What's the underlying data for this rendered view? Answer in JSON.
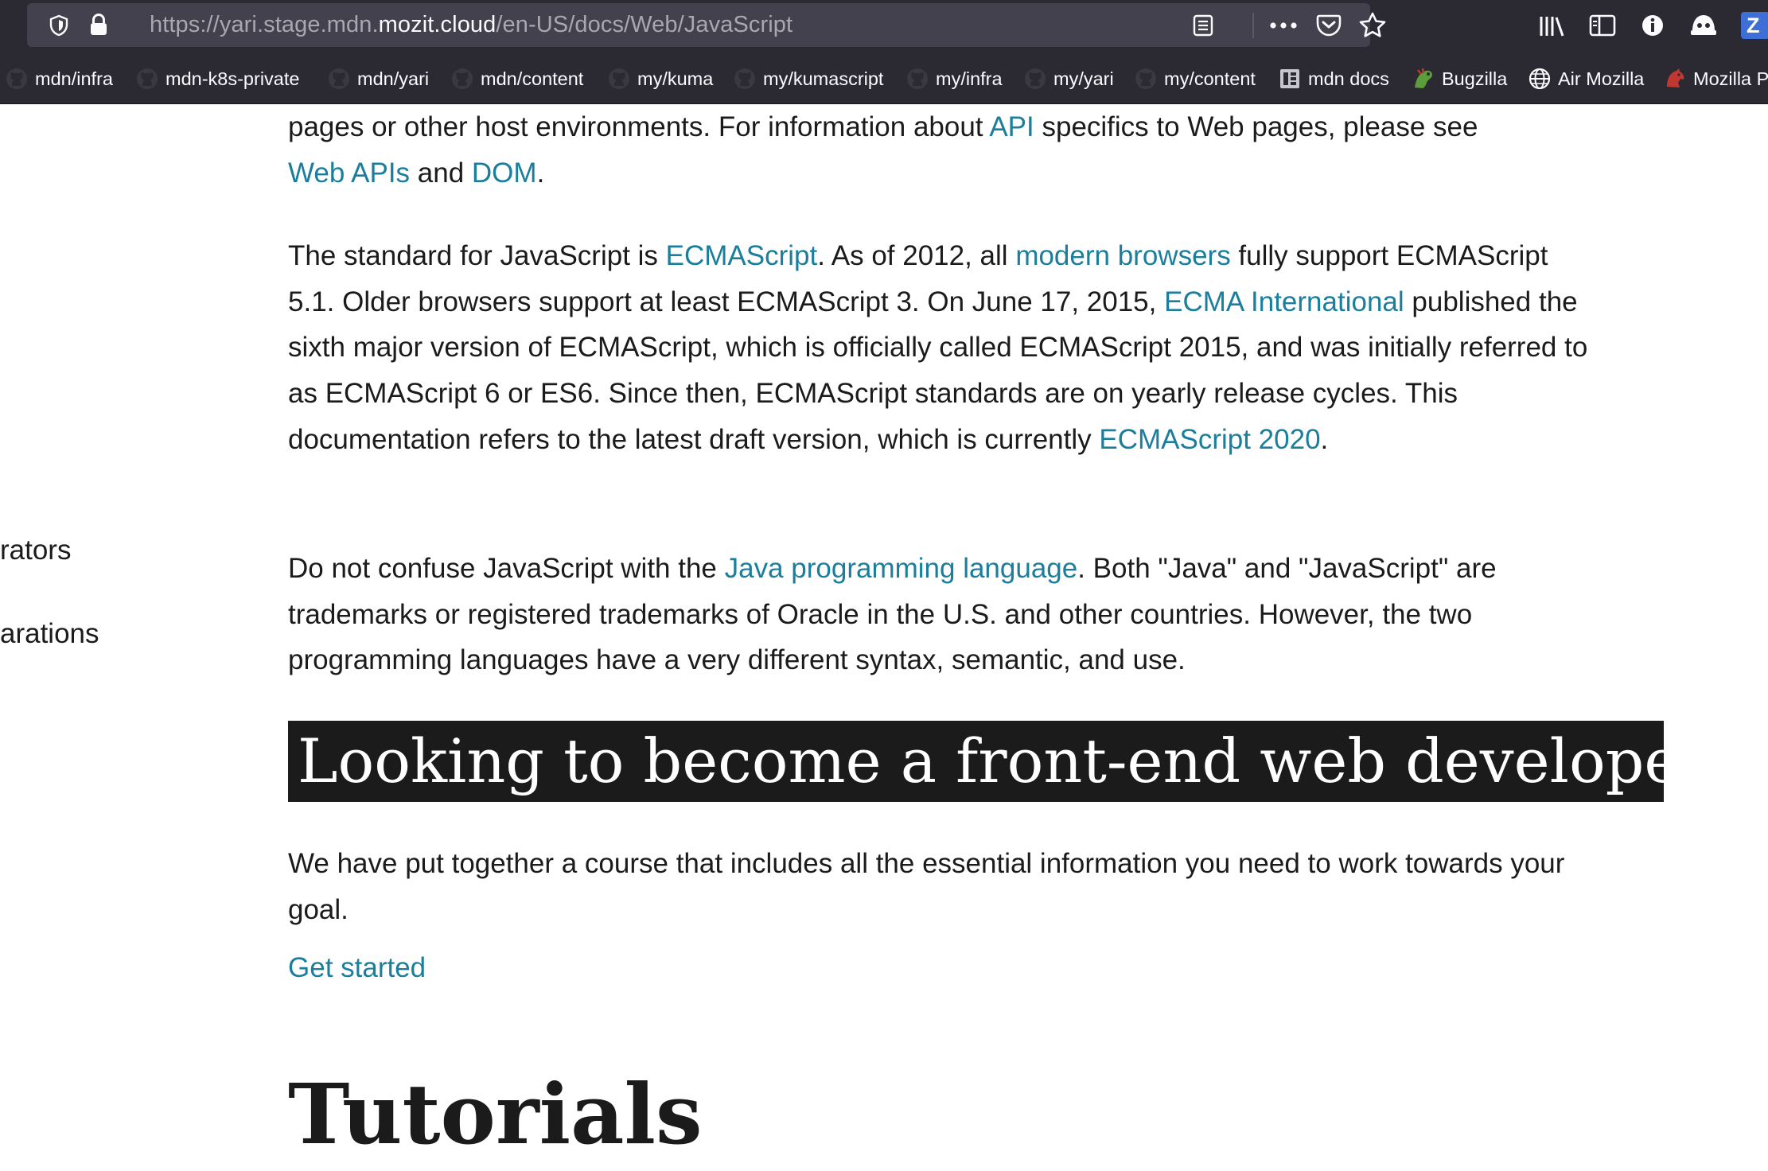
{
  "browser": {
    "url": {
      "scheme_prefix": "https://yari.stage.mdn.",
      "host": "mozit.cloud",
      "path": "/en-US/docs/Web/JavaScript"
    },
    "toolbar_icons": [
      "shield-icon",
      "lock-icon",
      "reader-view-icon",
      "more-actions-icon",
      "pocket-icon",
      "bookmark-star-icon",
      "library-icon",
      "sidebar-icon",
      "info-extension-icon",
      "helmet-extension-icon",
      "z-extension-icon"
    ],
    "z_label": "Z",
    "bookmarks": [
      {
        "label": "mdn/infra",
        "icon": "github-icon"
      },
      {
        "label": "mdn-k8s-private",
        "icon": "github-icon"
      },
      {
        "label": "mdn/yari",
        "icon": "github-icon"
      },
      {
        "label": "mdn/content",
        "icon": "github-icon"
      },
      {
        "label": "my/kuma",
        "icon": "github-icon"
      },
      {
        "label": "my/kumascript",
        "icon": "github-icon"
      },
      {
        "label": "my/infra",
        "icon": "github-icon"
      },
      {
        "label": "my/yari",
        "icon": "github-icon"
      },
      {
        "label": "my/content",
        "icon": "github-icon"
      },
      {
        "label": "mdn docs",
        "icon": "docs-icon"
      },
      {
        "label": "Bugzilla",
        "icon": "bugzilla-icon"
      },
      {
        "label": "Air Mozilla",
        "icon": "globe-icon"
      },
      {
        "label": "Mozilla P",
        "icon": "mozilla-icon"
      }
    ]
  },
  "sidebar": {
    "fragment_1": "rators",
    "fragment_2": "arations"
  },
  "content": {
    "para_intro": {
      "t1": "pages or other host environments. For information about ",
      "l1": "API",
      "t2": " specifics to Web pages, please see",
      "l2": "Web APIs",
      "t3": " and ",
      "l3": "DOM",
      "t4": "."
    },
    "para_standard": {
      "t1": "The standard for JavaScript is ",
      "l1": "ECMAScript",
      "t2": ". As of 2012, all ",
      "l2": "modern browsers",
      "t3": " fully support ECMAScript 5.1. Older browsers support at least ECMAScript 3. On June 17, 2015, ",
      "l3": "ECMA International",
      "t4": " published the sixth major version of ECMAScript, which is officially called ECMAScript 2015, and was initially referred to as ECMAScript 6 or ES6. Since then, ECMAScript standards are on yearly release cycles. This documentation refers to the latest draft version, which is currently ",
      "l4": "ECMAScript 2020",
      "t5": "."
    },
    "para_java": {
      "t1": "Do not confuse JavaScript with the ",
      "l1": "Java programming language",
      "t2": ". Both \"Java\" and \"JavaScript\" are trademarks or registered trademarks of Oracle in the U.S. and other countries. However, the two programming languages have a very different syntax, semantic, and use."
    },
    "cta_heading": "Looking to become a front-end web developer?",
    "cta_text": "We have put together a course that includes all the essential information you need to work towards your goal.",
    "get_started": "Get started",
    "tutorials_heading": "Tutorials"
  }
}
